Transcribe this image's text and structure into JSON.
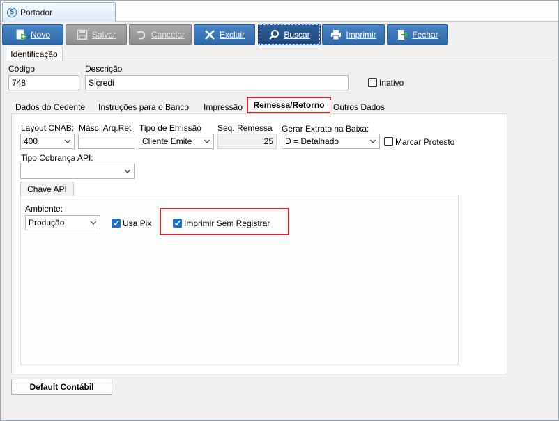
{
  "window": {
    "tab_title": "Portador"
  },
  "toolbar": {
    "novo": "Novo",
    "salvar": "Salvar",
    "cancelar": "Cancelar",
    "excluir": "Excluir",
    "buscar": "Buscar",
    "imprimir": "Imprimir",
    "fechar": "Fechar"
  },
  "identificacao": {
    "tab_label": "Identificação",
    "codigo_label": "Código",
    "codigo_value": "748",
    "descricao_label": "Descrição",
    "descricao_value": "Sicredi",
    "inativo_label": "Inativo",
    "inativo_checked": false
  },
  "tabs": [
    {
      "label": "Dados do Cedente"
    },
    {
      "label": "Instruções para o Banco"
    },
    {
      "label": "Impressão"
    },
    {
      "label": "Remessa/Retorno"
    },
    {
      "label": "Outros Dados"
    }
  ],
  "remessa": {
    "layout_cnab_label": "Layout CNAB:",
    "layout_cnab_value": "400",
    "masc_arq_ret_label": "Másc. Arq.Ret",
    "masc_arq_ret_value": "",
    "tipo_emissao_label": "Tipo de Emissão",
    "tipo_emissao_value": "Cliente Emite",
    "seq_remessa_label": "Seq. Remessa",
    "seq_remessa_value": "25",
    "gerar_extrato_label": "Gerar Extrato na Baixa:",
    "gerar_extrato_value": "D = Detalhado",
    "marcar_protesto_label": "Marcar Protesto",
    "marcar_protesto_checked": false,
    "tipo_cobranca_api_label": "Tipo Cobrança API:",
    "tipo_cobranca_api_value": ""
  },
  "chave_api": {
    "tab_label": "Chave API",
    "ambiente_label": "Ambiente:",
    "ambiente_value": "Produção",
    "usa_pix_label": "Usa Pix",
    "usa_pix_checked": true,
    "imprimir_sem_registrar_label": "Imprimir Sem Registrar",
    "imprimir_sem_registrar_checked": true
  },
  "footer": {
    "default_contabil": "Default Contábil"
  },
  "colors": {
    "button_blue": "#3a77b8",
    "button_disabled": "#9c9c9c",
    "highlight_red": "#d9242b",
    "check_blue": "#1f6fc3"
  }
}
